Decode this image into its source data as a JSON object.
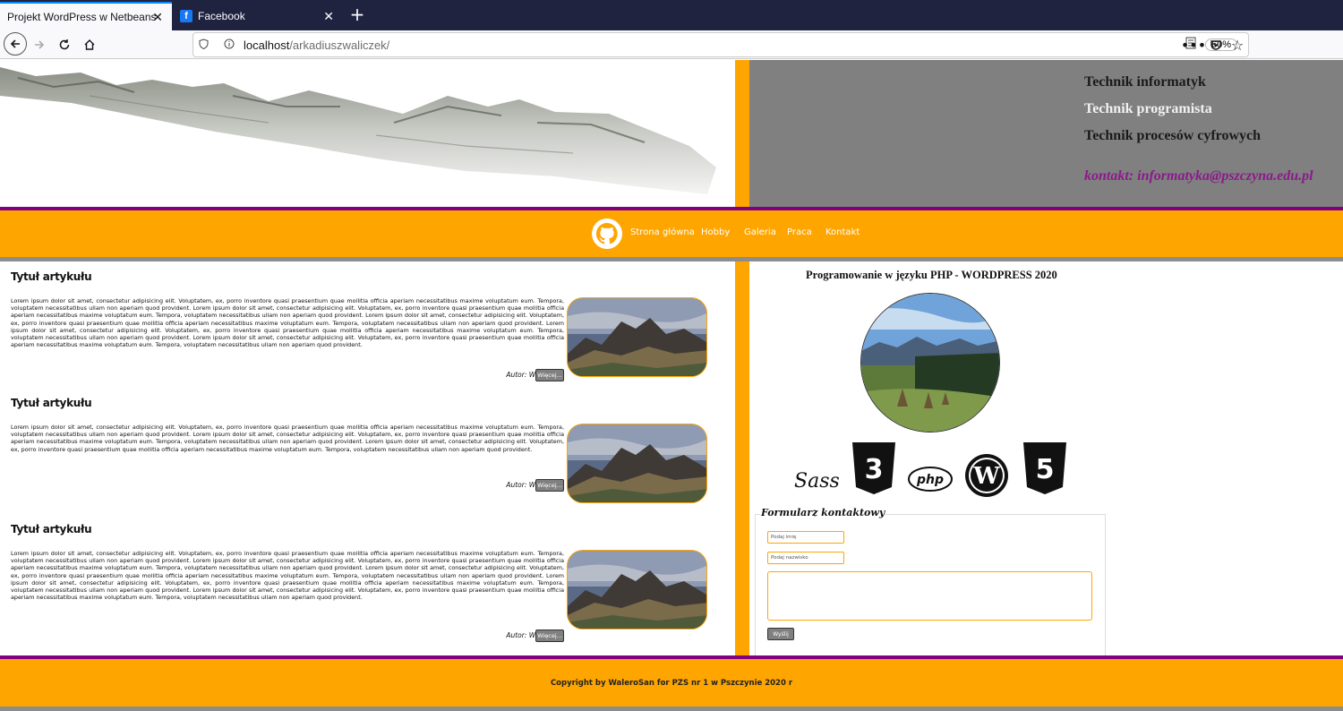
{
  "browser": {
    "tabs": [
      {
        "title": "Projekt WordPress w Netbeans",
        "active": true
      },
      {
        "title": "Facebook",
        "active": false
      }
    ],
    "new_tab": "+",
    "close": "✕",
    "url_host": "localhost",
    "url_path": "/arkadiuszwaliczek/",
    "zoom": "60%"
  },
  "header": {
    "lines": [
      "Technik informatyk",
      "Technik programista",
      "Technik procesów cyfrowych"
    ],
    "contact": "kontakt: informatyka@pszczyna.edu.pl"
  },
  "menu": {
    "items": [
      "Strona główna",
      "Hobby",
      "Galeria",
      "Praca",
      "Kontakt"
    ]
  },
  "articles": [
    {
      "title": "Tytuł artykułu",
      "body": "Lorem ipsum dolor sit amet, consectetur adipisicing elit. Voluptatem, ex, porro inventore quasi praesentium quae mollitia officia aperiam necessitatibus maxime voluptatum eum. Tempora, voluptatem necessitatibus ullam non aperiam quod provident. Lorem ipsum dolor sit amet, consectetur adipisicing elit. Voluptatem, ex, porro inventore quasi praesentium quae mollitia officia aperiam necessitatibus maxime voluptatum eum. Tempora, voluptatem necessitatibus ullam non aperiam quod provident. Lorem ipsum dolor sit amet, consectetur adipisicing elit. Voluptatem, ex, porro inventore quasi praesentium quae mollitia officia aperiam necessitatibus maxime voluptatum eum. Tempora, voluptatem necessitatibus ullam non aperiam quod provident. Lorem ipsum dolor sit amet, consectetur adipisicing elit. Voluptatem, ex, porro inventore quasi praesentium quae mollitia officia aperiam necessitatibus maxime voluptatum eum. Tempora, voluptatem necessitatibus ullam non aperiam quod provident. Lorem ipsum dolor sit amet, consectetur adipisicing elit. Voluptatem, ex, porro inventore quasi praesentium quae mollitia officia aperiam necessitatibus maxime voluptatum eum. Tempora, voluptatem necessitatibus ullam non aperiam quod provident.",
      "author": "Autor: Walerasan",
      "more": "Więcej..."
    },
    {
      "title": "Tytuł artykułu",
      "body": "Lorem ipsum dolor sit amet, consectetur adipisicing elit. Voluptatem, ex, porro inventore quasi praesentium quae mollitia officia aperiam necessitatibus maxime voluptatum eum. Tempora, voluptatem necessitatibus ullam non aperiam quod provident. Lorem ipsum dolor sit amet, consectetur adipisicing elit. Voluptatem, ex, porro inventore quasi praesentium quae mollitia officia aperiam necessitatibus maxime voluptatum eum. Tempora, voluptatem necessitatibus ullam non aperiam quod provident. Lorem ipsum dolor sit amet, consectetur adipisicing elit. Voluptatem, ex, porro inventore quasi praesentium quae mollitia officia aperiam necessitatibus maxime voluptatum eum. Tempora, voluptatem necessitatibus ullam non aperiam quod provident.",
      "author": "Autor: Walerasan",
      "more": "Więcej..."
    },
    {
      "title": "Tytuł artykułu",
      "body": "Lorem ipsum dolor sit amet, consectetur adipisicing elit. Voluptatem, ex, porro inventore quasi praesentium quae mollitia officia aperiam necessitatibus maxime voluptatum eum. Tempora, voluptatem necessitatibus ullam non aperiam quod provident. Lorem ipsum dolor sit amet, consectetur adipisicing elit. Voluptatem, ex, porro inventore quasi praesentium quae mollitia officia aperiam necessitatibus maxime voluptatum eum. Tempora, voluptatem necessitatibus ullam non aperiam quod provident. Lorem ipsum dolor sit amet, consectetur adipisicing elit. Voluptatem, ex, porro inventore quasi praesentium quae mollitia officia aperiam necessitatibus maxime voluptatum eum. Tempora, voluptatem necessitatibus ullam non aperiam quod provident. Lorem ipsum dolor sit amet, consectetur adipisicing elit. Voluptatem, ex, porro inventore quasi praesentium quae mollitia officia aperiam necessitatibus maxime voluptatum eum. Tempora, voluptatem necessitatibus ullam non aperiam quod provident. Lorem ipsum dolor sit amet, consectetur adipisicing elit. Voluptatem, ex, porro inventore quasi praesentium quae mollitia officia aperiam necessitatibus maxime voluptatum eum. Tempora, voluptatem necessitatibus ullam non aperiam quod provident.",
      "author": "Autor: Walerasan",
      "more": "Więcej..."
    }
  ],
  "sidebar": {
    "title": "Programowanie w języku PHP - WORDPRESS 2020",
    "tech_labels": [
      "Sass",
      "3",
      "php",
      "5"
    ]
  },
  "form": {
    "legend": "Formularz kontaktowy",
    "first_name_placeholder": "Podaj imię",
    "last_name_placeholder": "Podaj nazwisko",
    "send": "Wyślij"
  },
  "footer": {
    "copyright": "Copyright by WaleroSan for PZS nr 1 w Pszczynie 2020 r"
  },
  "colors": {
    "orange": "#ffa500",
    "purple": "#800080",
    "gray": "#808080"
  }
}
